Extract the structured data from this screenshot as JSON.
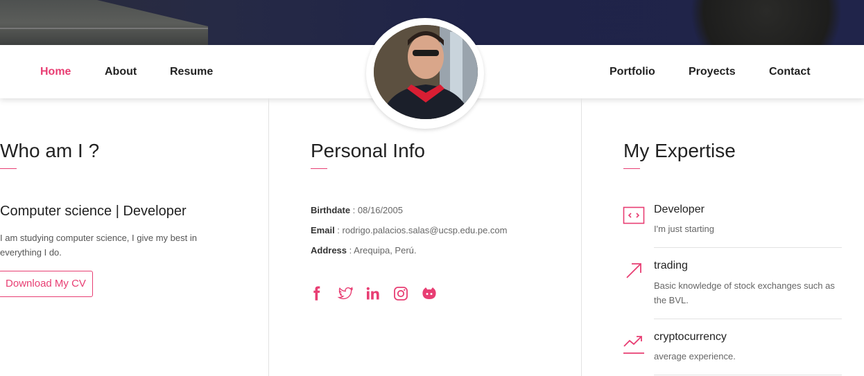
{
  "nav": {
    "left": [
      "Home",
      "About",
      "Resume"
    ],
    "right": [
      "Portfolio",
      "Proyects",
      "Contact"
    ],
    "active": "Home"
  },
  "about": {
    "title": "Who am I ?",
    "role": "Computer science | Developer",
    "bio": "I am studying computer science, I give my best in everything I do.",
    "cv_button": "Download My CV"
  },
  "personal": {
    "title": "Personal Info",
    "fields": [
      {
        "label": "Birthdate",
        "sep": " : ",
        "value": "08/16/2005"
      },
      {
        "label": "Email",
        "sep": " : ",
        "value": "rodrigo.palacios.salas@ucsp.edu.pe.com"
      },
      {
        "label": "Address",
        "sep": " : ",
        "value": "Arequipa, Perú."
      }
    ],
    "social": [
      "facebook-icon",
      "twitter-icon",
      "linkedin-icon",
      "instagram-icon",
      "github-icon"
    ]
  },
  "expertise": {
    "title": "My Expertise",
    "items": [
      {
        "title": "Developer",
        "desc": "I'm just starting",
        "icon": "code-icon"
      },
      {
        "title": "trading",
        "desc": "Basic knowledge of stock exchanges such as the BVL.",
        "icon": "arrow-up-right-icon"
      },
      {
        "title": "cryptocurrency",
        "desc": "average experience.",
        "icon": "trend-up-icon"
      }
    ]
  },
  "colors": {
    "accent": "#e83e73",
    "text": "#222222",
    "muted": "#666666",
    "divider": "#e2e2e2"
  }
}
